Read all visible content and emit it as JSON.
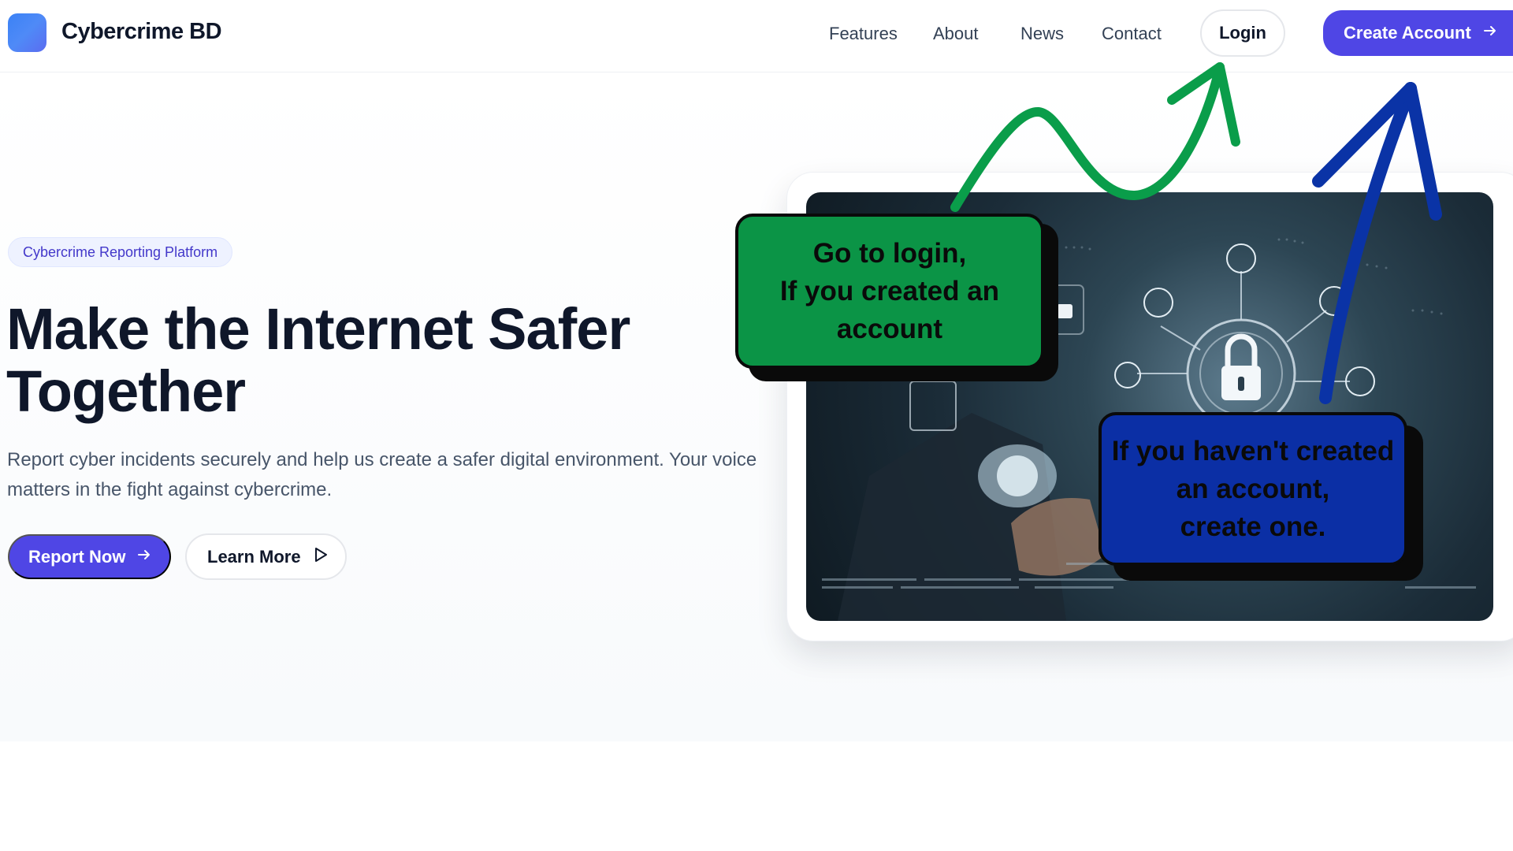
{
  "header": {
    "brand": "Cybercrime BD",
    "nav": [
      "Features",
      "About",
      "News",
      "Contact"
    ],
    "login_label": "Login",
    "create_label": "Create Account"
  },
  "hero": {
    "badge": "Cybercrime Reporting Platform",
    "title_line1": "Make the Internet Safer",
    "title_line2": "Together",
    "lead": "Report cyber incidents securely and help us create a safer digital environment. Your voice matters in the fight against cybercrime.",
    "report_label": "Report Now",
    "learn_label": "Learn More"
  },
  "annotations": {
    "green_text": "Go to login,\nIf you created an\naccount",
    "blue_text": "If you haven't created\nan account,\ncreate one."
  },
  "colors": {
    "primary": "#4f46e5",
    "green_callout": "#0b9446",
    "blue_callout": "#0b2fa5",
    "green_arrow": "#0a9d4a",
    "blue_arrow": "#0a33a6"
  },
  "icons": {
    "create_arrow": "arrow-right-icon",
    "report_arrow": "arrow-right-icon",
    "learn_play": "play-outline-icon",
    "photo_lock": "padlock-icon"
  }
}
